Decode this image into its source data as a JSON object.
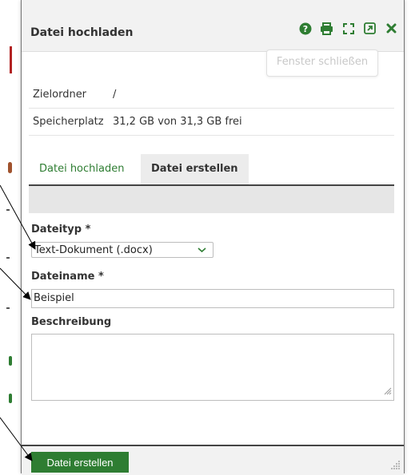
{
  "dialog": {
    "title": "Datei hochladen",
    "toolbar_icons": [
      "help-icon",
      "print-icon",
      "fullscreen-icon",
      "external-link-icon",
      "close-icon"
    ],
    "tooltip": "Fenster schließen"
  },
  "info": {
    "folder_label": "Zielordner",
    "folder_value": "/",
    "storage_label": "Speicherplatz",
    "storage_value": "31,2 GB von 31,3 GB frei"
  },
  "tabs": {
    "upload_label": "Datei hochladen",
    "create_label": "Datei erstellen",
    "active": "create"
  },
  "form": {
    "filetype_label": "Dateityp *",
    "filetype_value": "Text-Dokument (.docx)",
    "filename_label": "Dateiname *",
    "filename_value": "Beispiel",
    "description_label": "Beschreibung",
    "description_value": ""
  },
  "footer": {
    "create_button": "Datei erstellen"
  },
  "colors": {
    "accent": "#2e7d32",
    "titlebar": "#f2f2f2",
    "infobar": "#e6e6e6"
  }
}
